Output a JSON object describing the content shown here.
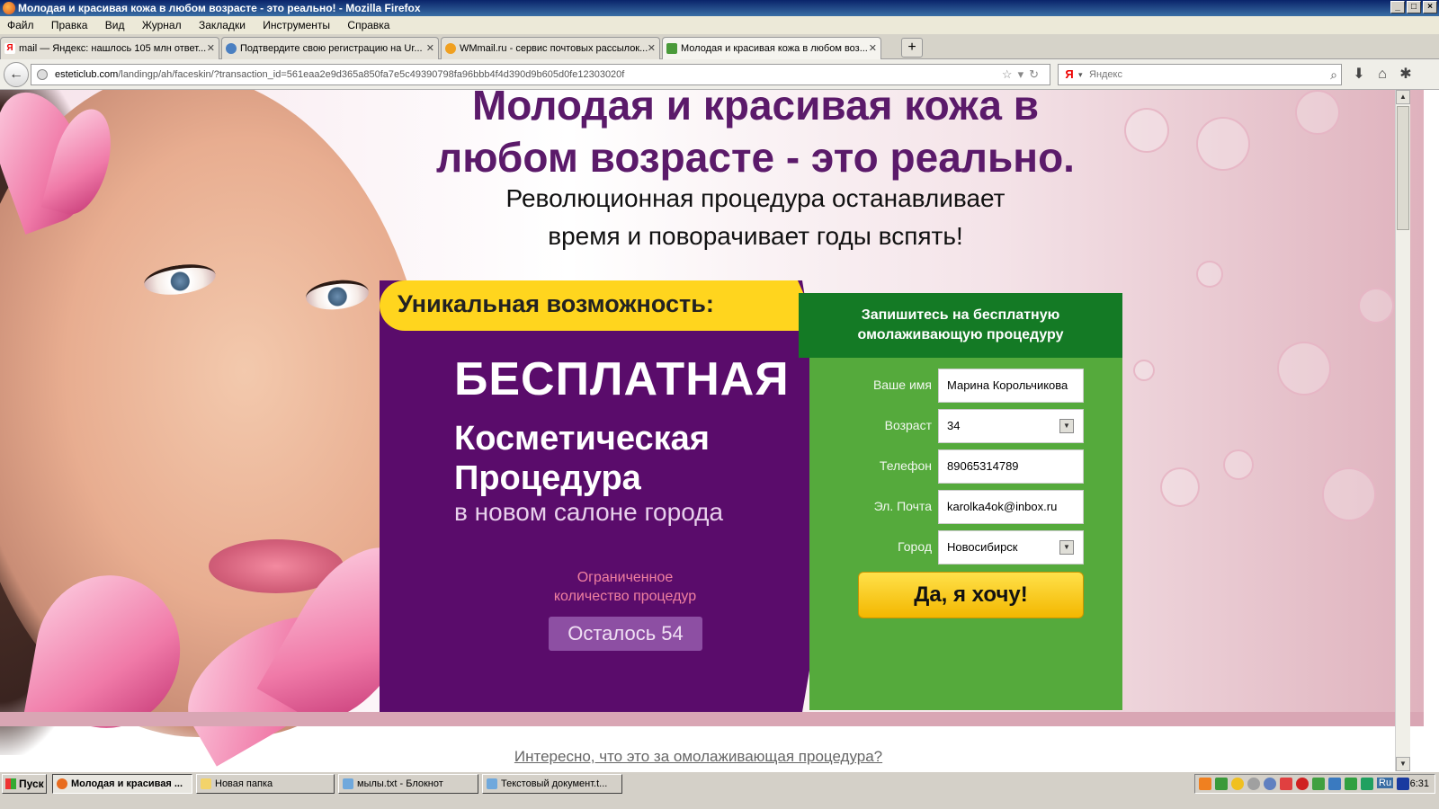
{
  "window": {
    "title": "Молодая и красивая кожа в любом возрасте - это реально! - Mozilla Firefox"
  },
  "menu": [
    "Файл",
    "Правка",
    "Вид",
    "Журнал",
    "Закладки",
    "Инструменты",
    "Справка"
  ],
  "tabs": [
    {
      "label": "mail — Яндекс: нашлось 105 млн ответ...",
      "icon": "yandex-icon"
    },
    {
      "label": "Подтвердите свою регистрацию на Ur...",
      "icon": "mail-icon"
    },
    {
      "label": "WMmail.ru - сервис почтовых рассылок...",
      "icon": "wmmail-icon"
    },
    {
      "label": "Молодая и красивая кожа в любом воз...",
      "icon": "site-icon",
      "active": true
    }
  ],
  "nav": {
    "url_domain": "esteticlub.com",
    "url_path": "/landingp/ah/faceskin/?transaction_id=561eaa2e9d365a850fa7e5c49390798fa96bbb4f4d390d9b605d0fe12303020f",
    "search_placeholder": "Яндекс"
  },
  "hero": {
    "headline_line1": "Молодая и красивая кожа в",
    "headline_line2": "любом возрасте - это реально.",
    "subhead_line1": "Революционная процедура останавливает",
    "subhead_line2": "время и поворачивает годы вспять!",
    "unique": "Уникальная возможность:",
    "free": "БЕСПЛАТНАЯ",
    "cosmetic": "Косметическая",
    "procedure": "Процедура",
    "salon": "в новом салоне города",
    "limited_line1": "Ограниченное",
    "limited_line2": "количество процедур",
    "remaining": "Осталось 54"
  },
  "form": {
    "heading_line1": "Запишитесь на бесплатную",
    "heading_line2": "омолаживающую процедуру",
    "name_label": "Ваше имя",
    "name_value": "Марина Корольчикова",
    "age_label": "Возраст",
    "age_value": "34",
    "phone_label": "Телефон",
    "phone_value": "89065314789",
    "email_label": "Эл. Почта",
    "email_value": "karolka4ok@inbox.ru",
    "city_label": "Город",
    "city_value": "Новосибирск",
    "submit": "Да, я хочу!"
  },
  "below": {
    "question": "Интересно, что это за омолаживающая процедура?"
  },
  "taskbar": {
    "start": "Пуск",
    "tasks": [
      {
        "label": "Молодая и красивая ...",
        "active": true
      },
      {
        "label": "Новая папка"
      },
      {
        "label": "мылы.txt - Блокнот"
      },
      {
        "label": "Текстовый документ.t..."
      }
    ],
    "lang": "Ru",
    "clock": "6:31"
  },
  "colors": {
    "purple": "#5a0c6b",
    "yellow": "#ffd51e",
    "green": "#55aa3c",
    "darkgreen": "#147a25",
    "headline": "#5b1a6a"
  }
}
